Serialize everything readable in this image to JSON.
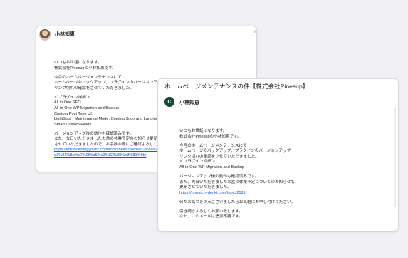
{
  "back_email": {
    "sender": "小林知恵",
    "date_fragment": "10",
    "body": [
      "いつもお世話になります。",
      "株式会社Pinesupの小林知恵です。",
      "",
      "今月のホームページメンテナンスにて",
      "ホームページのバックアップ、プラグインのバージョンアップ",
      "リンク切れの確認をさせていただきました。",
      "",
      "＜プラグイン詳細＞",
      "All in One SEO",
      "All-in-One WP Migration and Backup",
      "Custom Post Type UI",
      "LightStart - Maintenance Mode, Coming Soon and Landing P",
      "Smart Custom Fields",
      "",
      "バージョンアップ後の動作も確認済みです。",
      "また、先日いただきましたお盆の休業予定のお知らせ更新も",
      "させていただきましたので、お手数の際にご確認よろしくお"
    ],
    "link_lines": [
      "https://kotobuksangyo-inc.com/topic/news/%e3%81%8a%e7",
      "e3%81%8a%e7%9f%a5%e3%82%89%e3%81%9b/"
    ]
  },
  "front_email": {
    "subject": "ホームページメンテナンスの件【株式会社Pinesup】",
    "avatar_letter": "C",
    "sender": "小林知恵",
    "body": [
      "いつもお世話になります。",
      "株式会社Pinesupの小林知恵です。",
      "",
      "今月のホームページメンテナンスにて",
      "ホームページのバックアップ、プラグインのバージョンアップ",
      "リンク切れの確認をさせていただきました。",
      "＜プラグイン詳細＞",
      "All-in-One WP Migration and Backup",
      "",
      "バージョンアップ後の動作も確認済みです。",
      "また、先日いただきましたお盆の休業予定についてのお知らせも",
      "更新させていただきました。"
    ],
    "link": "https://maruichi-denki.com/topic/2181/",
    "closing": [
      "何かお気づきの点ございましたらお気軽にお申し付けください。",
      "",
      "引き続きよろしくお願い致します。",
      "なお、このメールは追加不要です。"
    ]
  }
}
